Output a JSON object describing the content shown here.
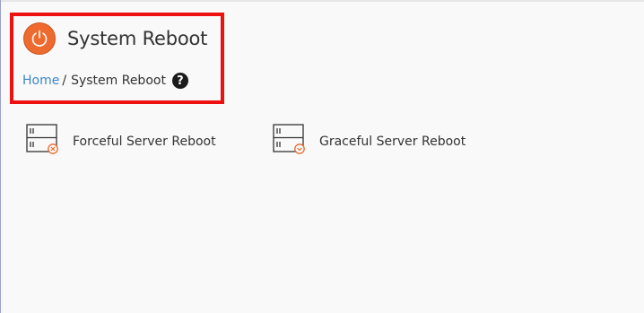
{
  "header": {
    "title": "System Reboot",
    "icon": "power-icon",
    "icon_color": "#ef6a2f"
  },
  "breadcrumb": {
    "home": "Home",
    "separator": "/",
    "current": "System Reboot",
    "help_glyph": "?"
  },
  "options": [
    {
      "label": "Forceful Server Reboot",
      "icon": "server-force-icon"
    },
    {
      "label": "Graceful Server Reboot",
      "icon": "server-graceful-icon"
    }
  ],
  "colors": {
    "highlight": "#ee1111",
    "link": "#3e85c8",
    "accent": "#ef6a2f"
  }
}
